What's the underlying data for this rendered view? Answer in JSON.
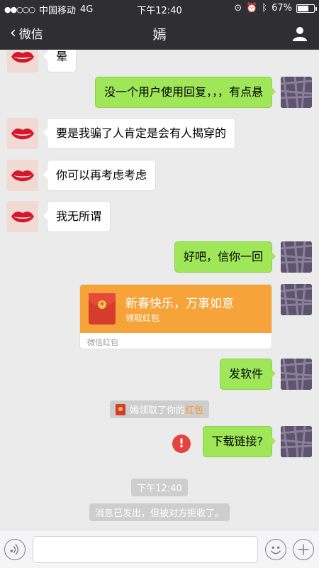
{
  "status_bar": {
    "signal": "●●○○○",
    "carrier": "中国移动",
    "network": "4G",
    "time": "下午12:40",
    "battery_text": "67%",
    "battery_level": 0.67
  },
  "nav": {
    "back_label": "微信",
    "title": "嫣"
  },
  "messages": [
    {
      "side": "in",
      "text": "晕"
    },
    {
      "side": "out",
      "text": "没一个用户使用回复，，，有点悬"
    },
    {
      "side": "in",
      "text": "要是我骗了人肯定是会有人揭穿的"
    },
    {
      "side": "in",
      "text": "你可以再考虑考虑"
    },
    {
      "side": "in",
      "text": "我无所谓"
    },
    {
      "side": "out",
      "text": "好吧，信你一回"
    },
    {
      "side": "out",
      "text": "发软件"
    },
    {
      "side": "out",
      "text": "下载链接?"
    }
  ],
  "red_packet": {
    "greeting": "新春快乐，万事如意",
    "action": "领取红包",
    "footer": "微信红包"
  },
  "system": {
    "received_prefix": "嫣领取了你的",
    "received_link": "红包",
    "timestamp": "下午12:40",
    "rejected": "消息已发出，但被对方拒收了。"
  },
  "error_mark": "!",
  "colors": {
    "bubble_out": "#9fe658",
    "navbar": "#2e2e33",
    "red_packet": "#f6a33a",
    "error": "#e64340"
  }
}
